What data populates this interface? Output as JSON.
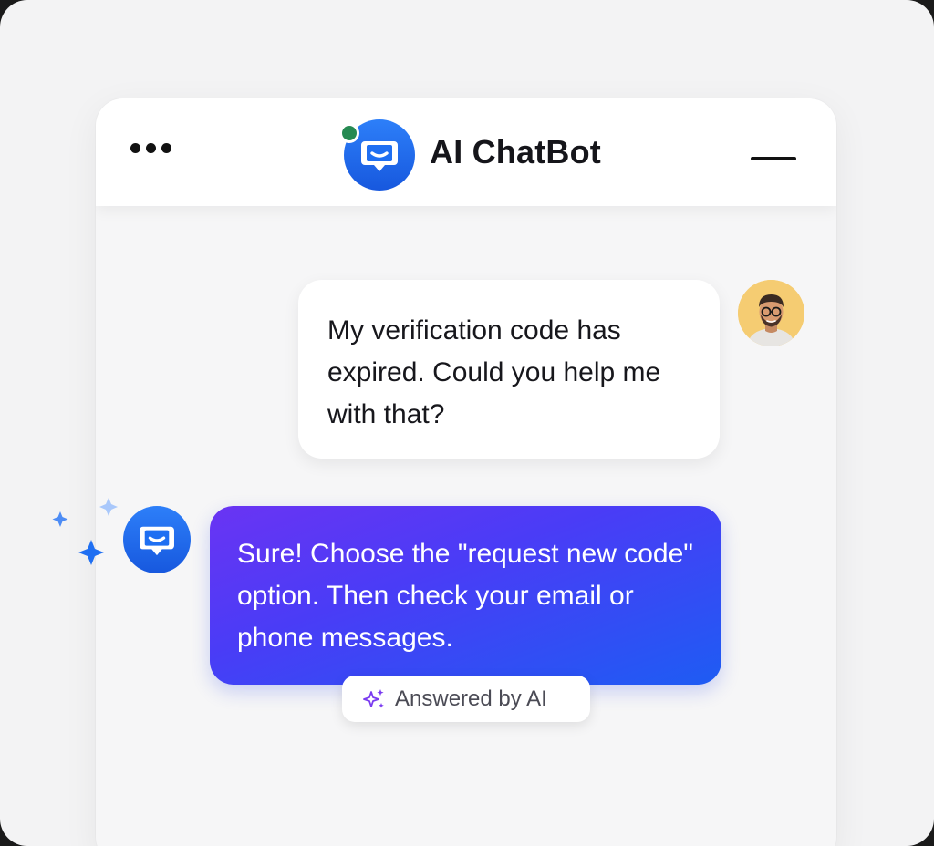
{
  "header": {
    "title": "AI ChatBot",
    "menu_icon": "more-horizontal-icon",
    "minimize_icon": "minimize-icon",
    "status": "online",
    "status_color": "#268a52"
  },
  "conversation": {
    "user_message": "My verification code has expired. Could you help me with that?",
    "bot_message": "Sure! Choose the \"request new code\" option. Then check your email or phone messages.",
    "bot_badge": "Answered by AI"
  },
  "colors": {
    "brand_blue": "#1f6ff2",
    "bubble_gradient_start": "#6a34f3",
    "bubble_gradient_end": "#1e5cf3",
    "badge_icon": "#7b3cf0"
  }
}
